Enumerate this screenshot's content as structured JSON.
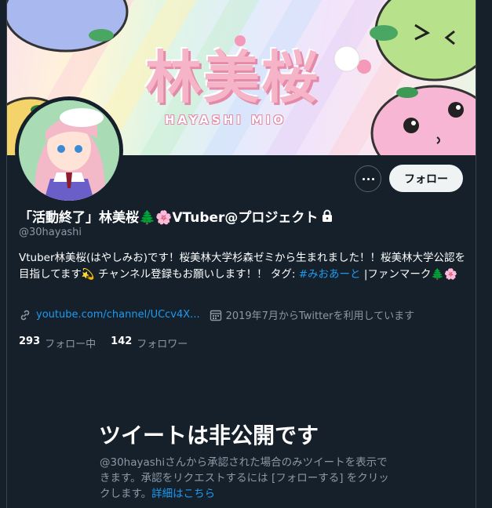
{
  "banner": {
    "title": "林美桜",
    "subtitle": "HAYASHI MIO"
  },
  "header": {
    "more_label": "⋯",
    "follow_label": "フォロー"
  },
  "profile": {
    "name": "「活動終了」林美桜🌲🌸VTuber@プロジェクト",
    "handle": "@30hayashi",
    "bio_line1": "Vtuber林美桜(はやしみお)です！桜美林大学杉森ゼミから生まれました！！桜美林大学公認を目指してます💫 チャンネル登録もお願いします！！ タグ: ",
    "bio_tag": "#みおあーと",
    "bio_line2": " |ファンマーク🌲🌸",
    "link": "youtube.com/channel/UCcv4X...",
    "joined": "2019年7月からTwitterを利用しています",
    "following_count": "293",
    "following_label": "フォロー中",
    "followers_count": "142",
    "followers_label": "フォロワー"
  },
  "private": {
    "title": "ツイートは非公開です",
    "desc": "@30hayashiさんから承認された場合のみツイートを表示できます。承認をリクエストするには [フォローする] をクリックします。",
    "link": "詳細はこちら"
  },
  "colors": {
    "background": "#15202b",
    "accent": "#1d9bf0",
    "secondary_text": "#8b98a5"
  }
}
